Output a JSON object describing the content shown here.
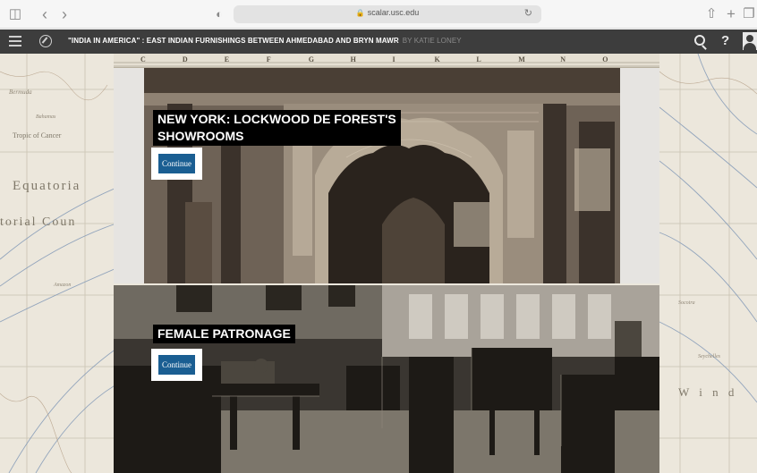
{
  "browser": {
    "url": "scalar.usc.edu"
  },
  "header": {
    "title": "\"INDIA IN AMERICA\" : EAST INDIAN FURNISHINGS BETWEEN AHMEDABAD AND BRYN MAWR",
    "author": "BY KATIE LONEY"
  },
  "sections": [
    {
      "title_line1": "NEW YORK: LOCKWOOD DE FOREST'S",
      "title_line2": "SHOWROOMS",
      "button": "Continue"
    },
    {
      "title": "FEMALE PATRONAGE",
      "button": "Continue"
    }
  ],
  "map_labels": {
    "equatoria": "Equatoria",
    "orial": "torial Coun",
    "cancer": "Tropic of Cancer",
    "wind": "W i n d"
  },
  "scale_letters": [
    "C",
    "D",
    "E",
    "F",
    "G",
    "H",
    "I",
    "K",
    "L",
    "M",
    "N",
    "O"
  ],
  "colors": {
    "header_bg": "#3d3d3d",
    "button_bg": "#1a5e92",
    "map_bg": "#ece7dc"
  }
}
